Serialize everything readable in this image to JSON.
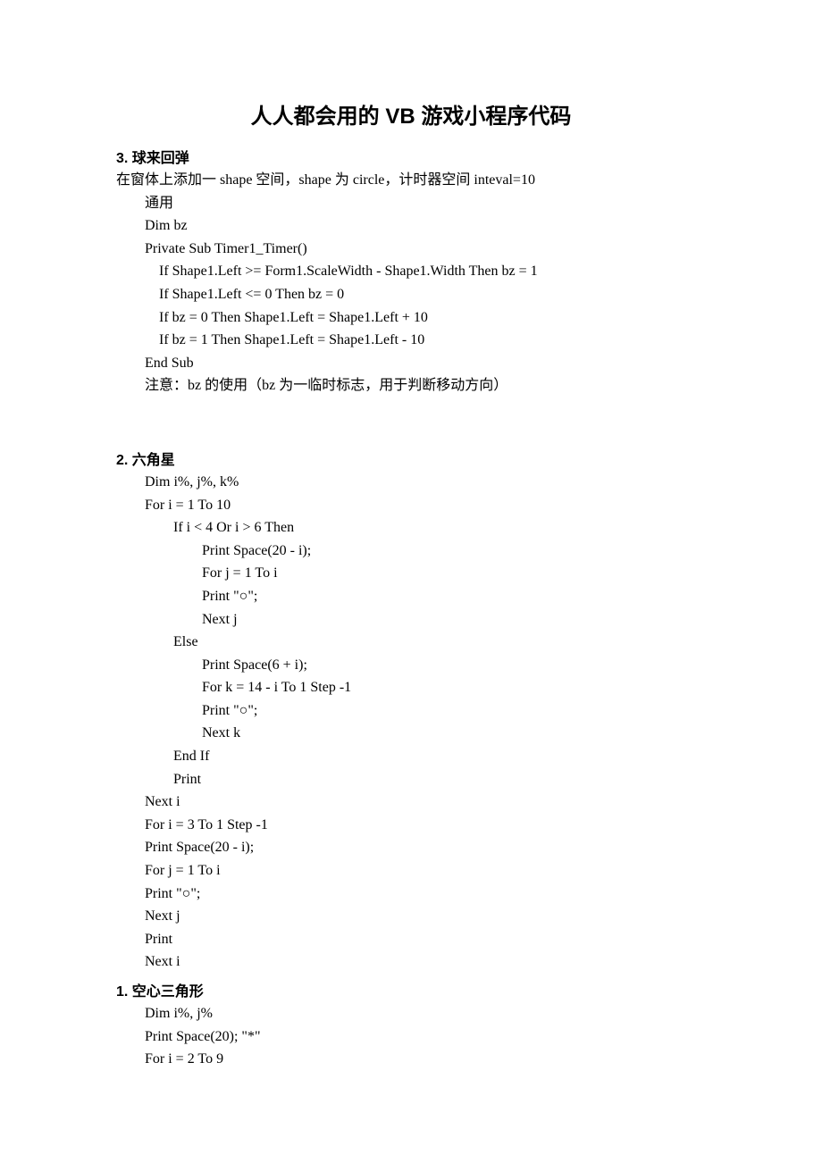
{
  "title": "人人都会用的 VB 游戏小程序代码",
  "sections": [
    {
      "heading": "3.  球来回弹",
      "lines": [
        "在窗体上添加一 shape 空间，shape 为 circle，计时器空间 inteval=10",
        "        通用",
        "        Dim bz",
        "",
        "        Private Sub Timer1_Timer()",
        "            If Shape1.Left >= Form1.ScaleWidth - Shape1.Width Then bz = 1",
        "            If Shape1.Left <= 0 Then bz = 0",
        "            If bz = 0 Then Shape1.Left = Shape1.Left + 10",
        "            If bz = 1 Then Shape1.Left = Shape1.Left - 10",
        "        End Sub",
        "        注意：bz 的使用（bz 为一临时标志，用于判断移动方向）"
      ],
      "gapAfter": "large"
    },
    {
      "heading": "2.  六角星",
      "lines": [
        "        Dim i%, j%, k%",
        "        For i = 1 To 10",
        "                If i < 4 Or i > 6 Then",
        "                        Print Space(20 - i);",
        "                        For j = 1 To i",
        "                        Print \"○\";",
        "                        Next j",
        "                Else",
        "                        Print Space(6 + i);",
        "                        For k = 14 - i To 1 Step -1",
        "                        Print \"○\";",
        "                        Next k",
        "                End If",
        "                Print",
        "        Next i",
        "        For i = 3 To 1 Step -1",
        "        Print Space(20 - i);",
        "        For j = 1 To i",
        "        Print \"○\";",
        "        Next j",
        "        Print",
        "        Next i"
      ],
      "gapAfter": "none"
    },
    {
      "heading": "1.  空心三角形",
      "lines": [
        "        Dim i%, j%",
        "        Print Space(20); \"*\"",
        "        For i = 2 To 9"
      ],
      "gapAfter": "none"
    }
  ]
}
